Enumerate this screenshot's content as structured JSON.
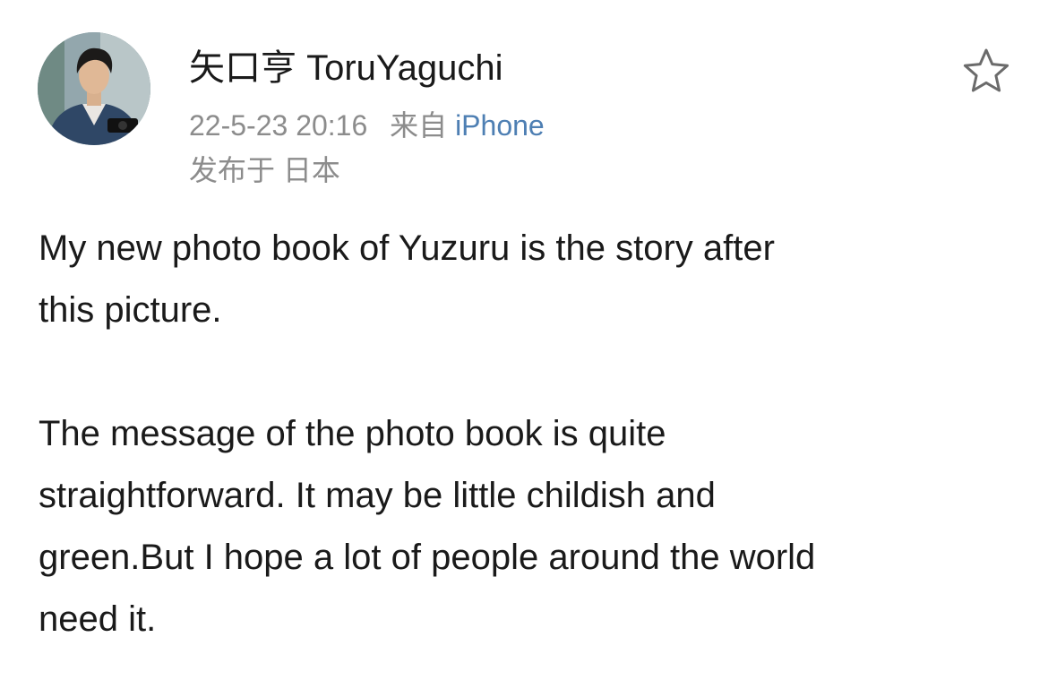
{
  "post": {
    "author": {
      "name": "矢口亨 ToruYaguchi"
    },
    "meta": {
      "time": "22-5-23 20:16",
      "source_prefix": "来自",
      "source": "iPhone",
      "location": "发布于 日本"
    },
    "favorite_icon": "star-outline-icon",
    "text": {
      "line1": "My new photo book of Yuzuru is the story after",
      "line2": "this picture.",
      "line3": "The message of the photo book is quite",
      "line4": "straightforward. It may be little childish and",
      "line5": "green.But I hope a lot of people around the world",
      "line6": "need it."
    },
    "colors": {
      "text": "#1a1a1a",
      "meta": "#8c8c8c",
      "link": "#4e7fb3",
      "background": "#ffffff"
    }
  }
}
